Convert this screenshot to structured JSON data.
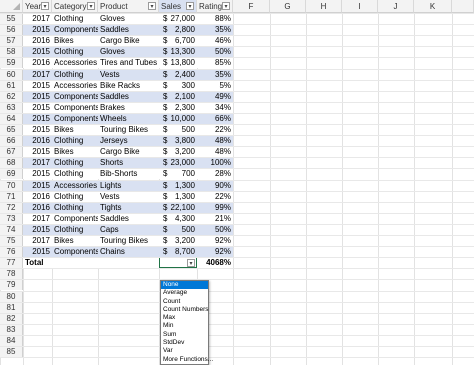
{
  "columns": {
    "row_corner": "",
    "headers": [
      "Year",
      "Category",
      "Product",
      "Sales",
      "Rating",
      "F",
      "G",
      "H",
      "I",
      "J",
      "K"
    ]
  },
  "rows": [
    {
      "n": "55",
      "year": "2017",
      "cat": "Clothing",
      "prod": "Gloves",
      "cur": "$",
      "sales": "27,000",
      "rating": "88%"
    },
    {
      "n": "56",
      "year": "2015",
      "cat": "Components",
      "prod": "Saddles",
      "cur": "$",
      "sales": "2,800",
      "rating": "35%"
    },
    {
      "n": "57",
      "year": "2016",
      "cat": "Bikes",
      "prod": "Cargo Bike",
      "cur": "$",
      "sales": "6,700",
      "rating": "46%"
    },
    {
      "n": "58",
      "year": "2015",
      "cat": "Clothing",
      "prod": "Gloves",
      "cur": "$",
      "sales": "13,300",
      "rating": "50%"
    },
    {
      "n": "59",
      "year": "2016",
      "cat": "Accessories",
      "prod": "Tires and Tubes",
      "cur": "$",
      "sales": "13,800",
      "rating": "85%"
    },
    {
      "n": "60",
      "year": "2017",
      "cat": "Clothing",
      "prod": "Vests",
      "cur": "$",
      "sales": "2,400",
      "rating": "35%"
    },
    {
      "n": "61",
      "year": "2015",
      "cat": "Accessories",
      "prod": "Bike Racks",
      "cur": "$",
      "sales": "300",
      "rating": "5%"
    },
    {
      "n": "62",
      "year": "2015",
      "cat": "Components",
      "prod": "Saddles",
      "cur": "$",
      "sales": "2,100",
      "rating": "49%"
    },
    {
      "n": "63",
      "year": "2015",
      "cat": "Components",
      "prod": "Brakes",
      "cur": "$",
      "sales": "2,300",
      "rating": "34%"
    },
    {
      "n": "64",
      "year": "2015",
      "cat": "Components",
      "prod": "Wheels",
      "cur": "$",
      "sales": "10,000",
      "rating": "66%"
    },
    {
      "n": "65",
      "year": "2015",
      "cat": "Bikes",
      "prod": "Touring Bikes",
      "cur": "$",
      "sales": "500",
      "rating": "22%"
    },
    {
      "n": "66",
      "year": "2016",
      "cat": "Clothing",
      "prod": "Jerseys",
      "cur": "$",
      "sales": "3,800",
      "rating": "48%"
    },
    {
      "n": "67",
      "year": "2015",
      "cat": "Bikes",
      "prod": "Cargo Bike",
      "cur": "$",
      "sales": "3,200",
      "rating": "48%"
    },
    {
      "n": "68",
      "year": "2017",
      "cat": "Clothing",
      "prod": "Shorts",
      "cur": "$",
      "sales": "23,000",
      "rating": "100%"
    },
    {
      "n": "69",
      "year": "2015",
      "cat": "Clothing",
      "prod": "Bib-Shorts",
      "cur": "$",
      "sales": "700",
      "rating": "28%"
    },
    {
      "n": "70",
      "year": "2015",
      "cat": "Accessories",
      "prod": "Lights",
      "cur": "$",
      "sales": "1,300",
      "rating": "90%"
    },
    {
      "n": "71",
      "year": "2016",
      "cat": "Clothing",
      "prod": "Vests",
      "cur": "$",
      "sales": "1,300",
      "rating": "22%"
    },
    {
      "n": "72",
      "year": "2016",
      "cat": "Clothing",
      "prod": "Tights",
      "cur": "$",
      "sales": "22,100",
      "rating": "99%"
    },
    {
      "n": "73",
      "year": "2017",
      "cat": "Components",
      "prod": "Saddles",
      "cur": "$",
      "sales": "4,300",
      "rating": "21%"
    },
    {
      "n": "74",
      "year": "2015",
      "cat": "Clothing",
      "prod": "Caps",
      "cur": "$",
      "sales": "500",
      "rating": "50%"
    },
    {
      "n": "75",
      "year": "2017",
      "cat": "Bikes",
      "prod": "Touring Bikes",
      "cur": "$",
      "sales": "3,200",
      "rating": "92%"
    },
    {
      "n": "76",
      "year": "2015",
      "cat": "Components",
      "prod": "Chains",
      "cur": "$",
      "sales": "8,700",
      "rating": "92%"
    }
  ],
  "total_row": {
    "n": "77",
    "label": "Total",
    "rating": "4068%"
  },
  "empty_rows": [
    "78",
    "79",
    "80",
    "81",
    "82",
    "83",
    "84",
    "85"
  ],
  "dropdown": {
    "options": [
      "None",
      "Average",
      "Count",
      "Count Numbers",
      "Max",
      "Min",
      "Sum",
      "StdDev",
      "Var",
      "More Functions..."
    ],
    "selected": "None"
  },
  "colors": {
    "band": "#d9e1f2",
    "header_band": "#d9e1f2",
    "selection": "#0078d7"
  },
  "icons": {
    "filter": "filter-dropdown-icon",
    "caret": "chevron-down-icon"
  }
}
